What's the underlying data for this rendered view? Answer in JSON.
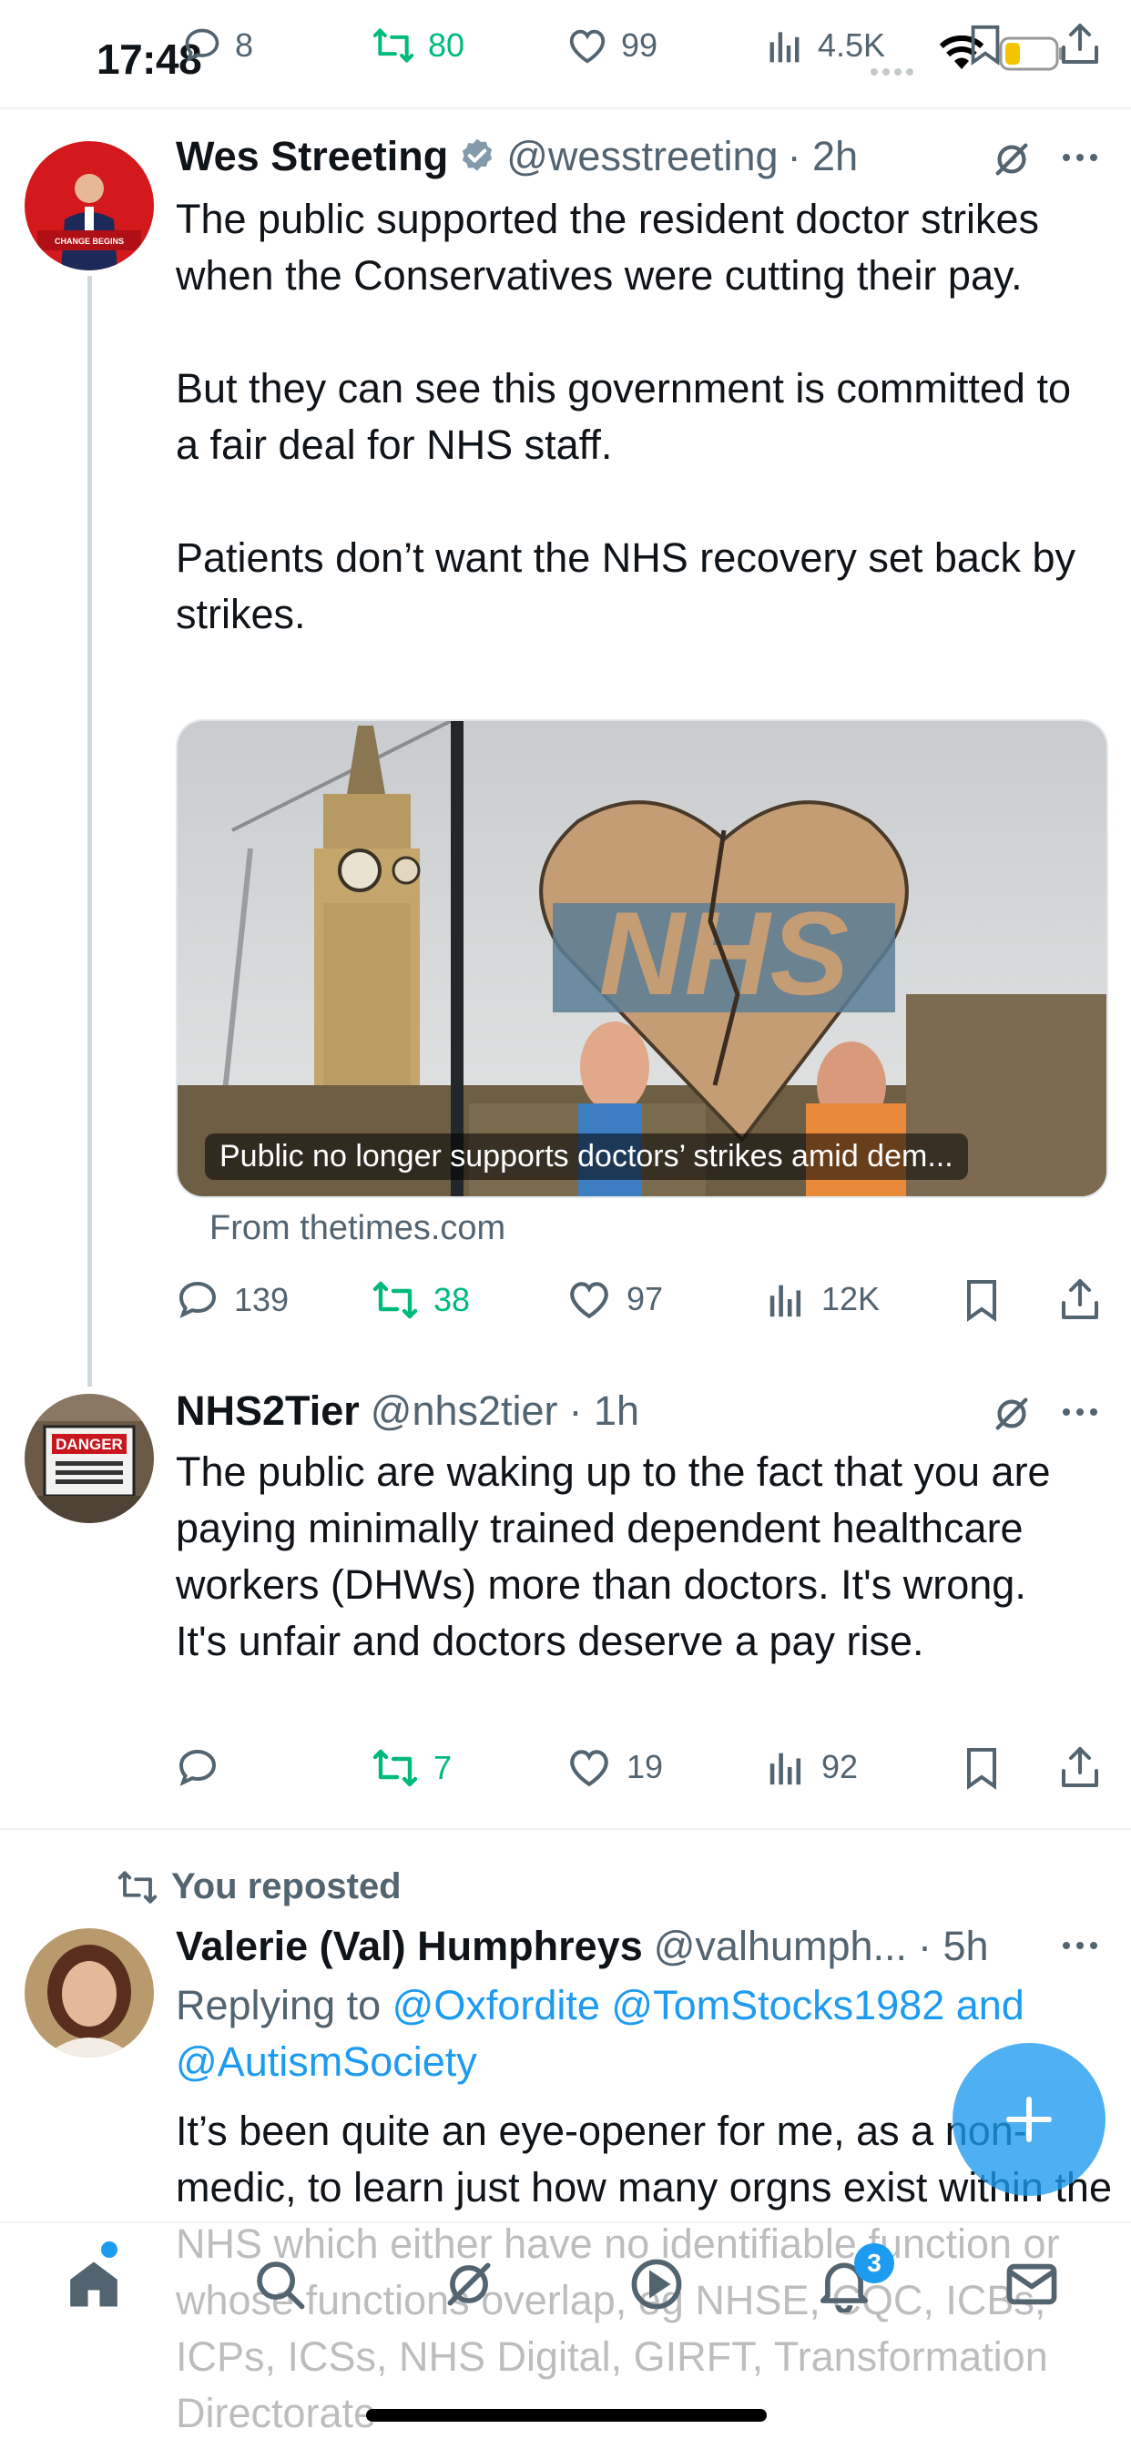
{
  "status_bar": {
    "time": "17:48"
  },
  "top_actions": {
    "replies": "8",
    "reposts": "80",
    "likes": "99",
    "views": "4.5K"
  },
  "tweets": [
    {
      "name": "Wes Streeting",
      "handle": "@wesstreeting",
      "time": "· 2h",
      "verified": true,
      "text": "The public supported the resident doctor strikes when the Conservatives were cutting their pay.\n\nBut they can see this government is committed to a fair deal for NHS staff.\n\nPatients don’t want the NHS recovery set back by strikes.",
      "card": {
        "caption": "Public no longer supports doctors’ strikes amid dem...",
        "source": "From thetimes.com",
        "sign_text": "NHS"
      },
      "actions": {
        "replies": "139",
        "reposts": "38",
        "likes": "97",
        "views": "12K"
      }
    },
    {
      "name": "NHS2Tier",
      "handle": "@nhs2tier",
      "time": "· 1h",
      "text": "The public are waking up to the fact that you are paying minimally trained dependent healthcare workers (DHWs) more than doctors. It's wrong. It's unfair and doctors deserve a pay rise.",
      "actions": {
        "replies": "",
        "reposts": "7",
        "likes": "19",
        "views": "92"
      },
      "avatar_sign": "DANGER"
    },
    {
      "context": "You reposted",
      "name": "Valerie (Val) Humphreys",
      "handle": "@valhumph...",
      "time": "· 5h",
      "replying_prefix": "Replying to",
      "replying_to": "@Oxfordite @TomStocks1982 and @AutismSociety",
      "text": "It’s been quite an eye-opener for me, as a non-medic, to learn just how many orgns exist within the NHS which either have no identifiable function or whose functions overlap, eg NHSE, CQC, ICBs, ICPs, ICSs, NHS Digital, GIRFT, Transformation Directorate"
    }
  ],
  "bottom_nav": {
    "notification_badge": "3"
  },
  "colors": {
    "accent": "#1d9bf0",
    "repost_green": "#00ba7c",
    "muted": "#536471"
  }
}
